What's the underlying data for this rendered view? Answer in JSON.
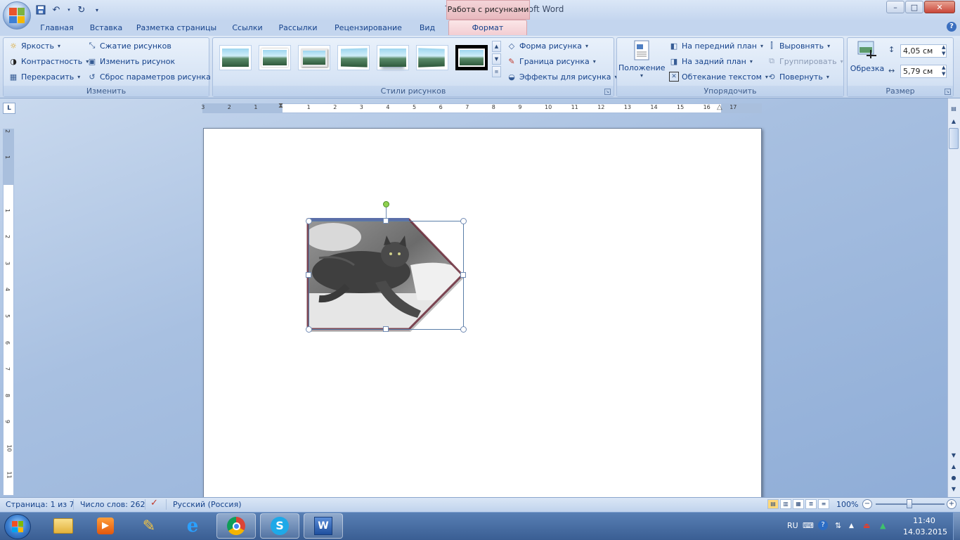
{
  "window": {
    "title": "Test 1.docx - Microsoft Word",
    "context_header": "Работа с рисунками",
    "controls": {
      "minimize": "–",
      "maximize": "□",
      "close": "✕"
    }
  },
  "qat": {
    "save_icon": "save-icon",
    "undo_icon": "undo-icon",
    "redo_icon": "redo-icon",
    "customize_icon": "qat-dropdown-icon"
  },
  "tabs": [
    {
      "label": "Главная"
    },
    {
      "label": "Вставка"
    },
    {
      "label": "Разметка страницы"
    },
    {
      "label": "Ссылки"
    },
    {
      "label": "Рассылки"
    },
    {
      "label": "Рецензирование"
    },
    {
      "label": "Вид"
    },
    {
      "label": "Формат",
      "active": true
    }
  ],
  "help": "?",
  "ribbon": {
    "adjust": {
      "label": "Изменить",
      "brightness": "Яркость",
      "contrast": "Контрастность",
      "recolor": "Перекрасить",
      "compress": "Сжатие рисунков",
      "change": "Изменить рисунок",
      "reset": "Сброс параметров рисунка"
    },
    "styles": {
      "label": "Стили рисунков",
      "shape": "Форма рисунка",
      "border": "Граница рисунка",
      "effects": "Эффекты для рисунка"
    },
    "arrange": {
      "label": "Упорядочить",
      "position": "Положение",
      "bring_front": "На передний план",
      "send_back": "На задний план",
      "wrap": "Обтекание текстом",
      "align": "Выровнять",
      "group": "Группировать",
      "rotate": "Повернуть"
    },
    "size": {
      "label": "Размер",
      "crop": "Обрезка",
      "height": "4,05 см",
      "width": "5,79 см"
    }
  },
  "ruler": {
    "h_numbers": [
      "3",
      "2",
      "1",
      "1",
      "2",
      "3",
      "4",
      "5",
      "6",
      "7",
      "8",
      "9",
      "10",
      "11",
      "12",
      "13",
      "14",
      "15",
      "16",
      "17"
    ],
    "v_numbers": [
      "2",
      "1",
      "1",
      "2",
      "3",
      "4",
      "5",
      "6",
      "7",
      "8",
      "9",
      "10",
      "11"
    ]
  },
  "status": {
    "page": "Страница: 1 из 7",
    "words": "Число слов: 262",
    "language": "Русский (Россия)",
    "zoom": "100%"
  },
  "taskbar": {
    "lang": "RU",
    "time": "11:40",
    "date": "14.03.2015"
  }
}
